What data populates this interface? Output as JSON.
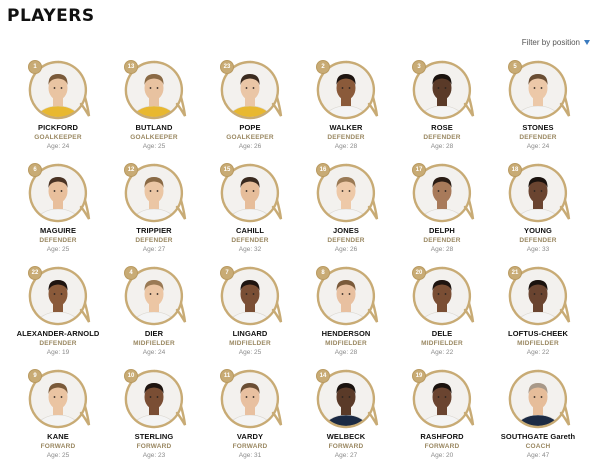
{
  "page": {
    "title": "PLAYERS"
  },
  "filter": {
    "label": "Filter by position",
    "icon": "triangle-down-icon",
    "icon_color": "#3b7bbf"
  },
  "colors": {
    "gold": "#c8ab75",
    "medal_bg": "#ffffff",
    "position": "#9a8862"
  },
  "age_prefix": "Age:",
  "players": [
    {
      "number": "1",
      "name": "PICKFORD",
      "position": "GOALKEEPER",
      "age": "24",
      "kit": "#e8b830",
      "skin": "#e9c4a2",
      "hair": "#7a5a3a"
    },
    {
      "number": "13",
      "name": "BUTLAND",
      "position": "GOALKEEPER",
      "age": "25",
      "kit": "#e8b830",
      "skin": "#e8c2a0",
      "hair": "#8a6a45"
    },
    {
      "number": "23",
      "name": "POPE",
      "position": "GOALKEEPER",
      "age": "26",
      "kit": "#e8b830",
      "skin": "#eac6a6",
      "hair": "#3a2a1f"
    },
    {
      "number": "2",
      "name": "WALKER",
      "position": "DEFENDER",
      "age": "28",
      "kit": "#f4f4f4",
      "skin": "#8a5a3a",
      "hair": "#1e1410"
    },
    {
      "number": "3",
      "name": "ROSE",
      "position": "DEFENDER",
      "age": "28",
      "kit": "#f4f4f4",
      "skin": "#5a3a28",
      "hair": "#1a120e"
    },
    {
      "number": "5",
      "name": "STONES",
      "position": "DEFENDER",
      "age": "24",
      "kit": "#f4f4f4",
      "skin": "#ecc8a8",
      "hair": "#6a4e34"
    },
    {
      "number": "6",
      "name": "MAGUIRE",
      "position": "DEFENDER",
      "age": "25",
      "kit": "#f4f4f4",
      "skin": "#e8bf9c",
      "hair": "#4a3324"
    },
    {
      "number": "12",
      "name": "TRIPPIER",
      "position": "DEFENDER",
      "age": "27",
      "kit": "#f4f4f4",
      "skin": "#ebc6a4",
      "hair": "#8a6a45"
    },
    {
      "number": "15",
      "name": "CAHILL",
      "position": "DEFENDER",
      "age": "32",
      "kit": "#f4f4f4",
      "skin": "#e6bd9a",
      "hair": "#3a2a1f"
    },
    {
      "number": "16",
      "name": "JONES",
      "position": "DEFENDER",
      "age": "26",
      "kit": "#f4f4f4",
      "skin": "#eec9a8",
      "hair": "#9a7a55"
    },
    {
      "number": "17",
      "name": "DELPH",
      "position": "DEFENDER",
      "age": "28",
      "kit": "#f4f4f4",
      "skin": "#a87a5a",
      "hair": "#2a1c14"
    },
    {
      "number": "18",
      "name": "YOUNG",
      "position": "DEFENDER",
      "age": "33",
      "kit": "#f4f4f4",
      "skin": "#6a4430",
      "hair": "#1a120e"
    },
    {
      "number": "22",
      "name": "ALEXANDER-ARNOLD",
      "position": "DEFENDER",
      "age": "19",
      "kit": "#f4f4f4",
      "skin": "#8a5a3a",
      "hair": "#1e1410"
    },
    {
      "number": "4",
      "name": "DIER",
      "position": "MIDFIELDER",
      "age": "24",
      "kit": "#f4f4f4",
      "skin": "#ecc6a4",
      "hair": "#9a7a55"
    },
    {
      "number": "7",
      "name": "LINGARD",
      "position": "MIDFIELDER",
      "age": "25",
      "kit": "#f4f4f4",
      "skin": "#7a4e34",
      "hair": "#1e1410"
    },
    {
      "number": "8",
      "name": "HENDERSON",
      "position": "MIDFIELDER",
      "age": "28",
      "kit": "#f4f4f4",
      "skin": "#e8c0a0",
      "hair": "#7a5a3a"
    },
    {
      "number": "20",
      "name": "DELE",
      "position": "MIDFIELDER",
      "age": "22",
      "kit": "#f4f4f4",
      "skin": "#7a4e34",
      "hair": "#1e1410"
    },
    {
      "number": "21",
      "name": "LOFTUS-CHEEK",
      "position": "MIDFIELDER",
      "age": "22",
      "kit": "#f4f4f4",
      "skin": "#6a4430",
      "hair": "#1a120e"
    },
    {
      "number": "9",
      "name": "KANE",
      "position": "FORWARD",
      "age": "25",
      "kit": "#f4f4f4",
      "skin": "#eac4a2",
      "hair": "#7a5a3a"
    },
    {
      "number": "10",
      "name": "STERLING",
      "position": "FORWARD",
      "age": "23",
      "kit": "#f4f4f4",
      "skin": "#7a4e34",
      "hair": "#1e1410"
    },
    {
      "number": "11",
      "name": "VARDY",
      "position": "FORWARD",
      "age": "31",
      "kit": "#f4f4f4",
      "skin": "#e8c0a0",
      "hair": "#6a4e34"
    },
    {
      "number": "14",
      "name": "WELBECK",
      "position": "FORWARD",
      "age": "27",
      "kit": "#1b2a44",
      "skin": "#5a3a28",
      "hair": "#1a120e"
    },
    {
      "number": "19",
      "name": "RASHFORD",
      "position": "FORWARD",
      "age": "20",
      "kit": "#f4f4f4",
      "skin": "#6a4430",
      "hair": "#1a120e"
    },
    {
      "number": "",
      "name": "SOUTHGATE Gareth",
      "position": "COACH",
      "age": "47",
      "kit": "#1b2a44",
      "skin": "#e6bd9a",
      "hair": "#a89888"
    }
  ]
}
